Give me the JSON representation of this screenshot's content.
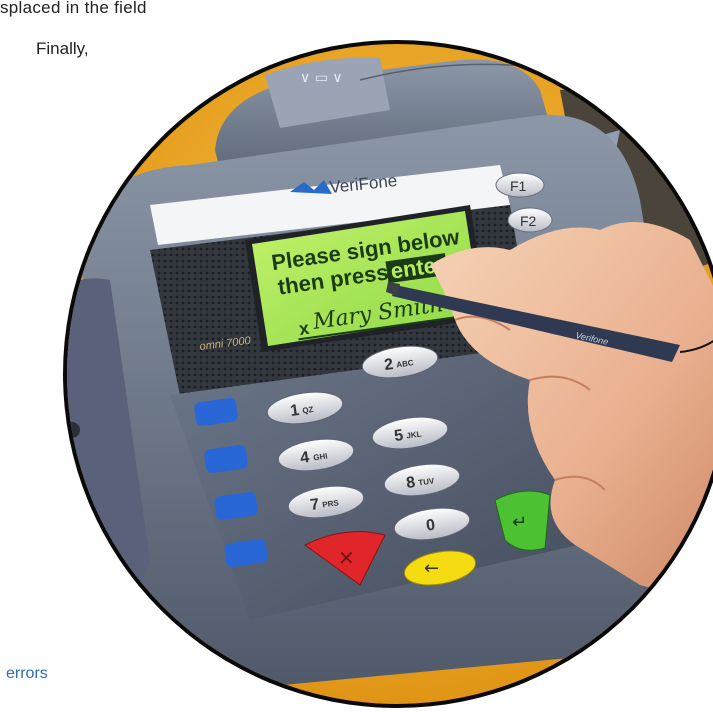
{
  "document": {
    "text_line_1": "splaced in the field",
    "text_line_2": "Finally,",
    "link_text": "errors"
  },
  "terminal": {
    "brand": "VeriFone",
    "model": "omni 7000",
    "screen_line_1": "Please sign below",
    "screen_line_2_prefix": "then press",
    "screen_line_2_highlight": "enter",
    "signature_mark": "x",
    "signature": "Mary Smith",
    "function_keys": [
      "F1",
      "F2"
    ],
    "keypad": [
      {
        "digit": "1",
        "letters": "QZ"
      },
      {
        "digit": "2",
        "letters": "ABC"
      },
      {
        "digit": "4",
        "letters": "GHI"
      },
      {
        "digit": "5",
        "letters": "JKL"
      },
      {
        "digit": "7",
        "letters": "PRS"
      },
      {
        "digit": "8",
        "letters": "TUV"
      },
      {
        "digit": "0",
        "letters": ""
      }
    ],
    "stylus_label": "Verifone"
  },
  "colors": {
    "backdrop": "#f2a81d",
    "housing": "#6f7b8c",
    "lcd": "#9fe35a",
    "cancel_key": "#e0262a",
    "clear_key": "#f5dc12",
    "enter_key": "#4cc232",
    "side_key": "#2a67d6"
  }
}
